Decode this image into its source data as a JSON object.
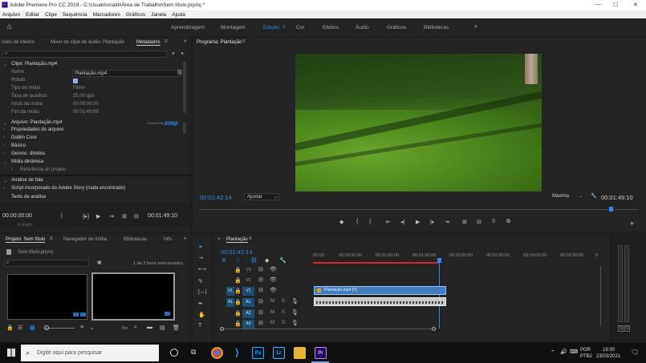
{
  "window": {
    "title": "Adobe Premiere Pro CC 2019 - C:\\Usuários\\atili\\Área de Trabalho\\Sem título.prproj *"
  },
  "menu": [
    "Arquivo",
    "Editar",
    "Clipe",
    "Sequência",
    "Marcadores",
    "Gráficos",
    "Janela",
    "Ajuda"
  ],
  "workspaces": [
    "Aprendizagem",
    "Montagem",
    "Edição",
    "Cor",
    "Efeitos",
    "Áudio",
    "Gráficos",
    "Bibliotecas"
  ],
  "source_panel": {
    "tabs": [
      "roles de efeitos",
      "Mixer de clipe de áudio: Plantação",
      "Metadados"
    ],
    "clip_header": "Clipe: Plantação.mp4",
    "fields": [
      {
        "label": "Nome",
        "value": "Plantação.mp4"
      },
      {
        "label": "Rótulo",
        "value": ""
      },
      {
        "label": "Tipo de mídia",
        "value": "Filme"
      },
      {
        "label": "Taxa de quadros",
        "value": "25,00 qps"
      },
      {
        "label": "Início da mídia",
        "value": "00:00:00:00"
      },
      {
        "label": "Fim da mídia",
        "value": "00:01:49:09"
      }
    ],
    "file_header": "Arquivo:  Plantação.mp4",
    "powered_by": "Powered By",
    "xmp": "xmp",
    "sections": [
      "Propriedades do arquivo",
      "Dublin Core",
      "Básico",
      "Gerenc. direitos",
      "Mídia dinâmica",
      "Referência do projeto"
    ],
    "speech_header": "Análise de fala",
    "speech_text": "Script incorporado do Adobe Story (nada encontrado)",
    "speech_sub": "Texto de análise",
    "tc_left": "00:00:00:00",
    "tc_right": "00:01:49:10",
    "footer": "Extraído"
  },
  "program": {
    "title": "Programa: Plantação",
    "timecode": "00:01:42:14",
    "fit": "Ajustar",
    "quality": "Máxima",
    "duration": "00:01:49:10"
  },
  "project": {
    "tabs": [
      "Projeto: Sem título",
      "Navegador de mídia",
      "Bibliotecas",
      "Info"
    ],
    "file": "Sem título.prproj",
    "selection": "1 de 2 itens selecionados",
    "bin_label": "Bin"
  },
  "timeline": {
    "title": "Plantação",
    "timecode": "00:01:42:14",
    "ruler": [
      "00:00",
      "00:00:30:00",
      "00:01:00:00",
      "00:01:30:00",
      "00:02:00:00",
      "00:02:30:00",
      "00:03:00:00",
      "00:03:30:00",
      "0"
    ],
    "video_tracks": [
      "V3",
      "V2",
      "V1"
    ],
    "audio_tracks": [
      "A1",
      "A2",
      "A3"
    ],
    "video_clip": "Plantação.mp4 [V]",
    "meter_labels": [
      "S",
      "S"
    ]
  },
  "taskbar": {
    "search_placeholder": "Digite aqui para pesquisar",
    "lang": "POR",
    "lang2": "PTB2",
    "time": "19:30",
    "date": "23/03/2021",
    "apps": [
      "Ps",
      "Lr",
      "Pr"
    ]
  },
  "colors": {
    "accent": "#2d8ceb",
    "clip_video": "#3f7dbf",
    "clip_audio": "#c8c8c8",
    "playhead": "#2d8ceb",
    "timeline_red": "#d12a2a"
  }
}
